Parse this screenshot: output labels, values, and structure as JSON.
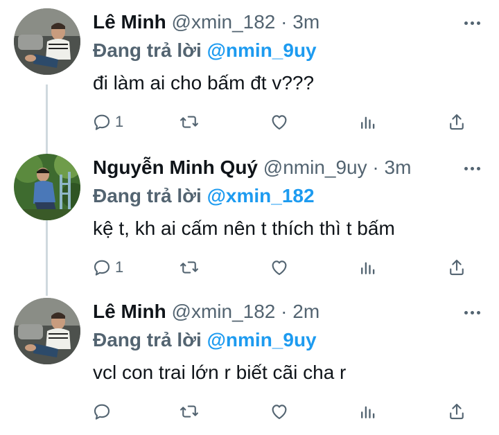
{
  "tweets": [
    {
      "name": "Lê Minh",
      "handle": "@xmin_182",
      "time": "· 3m",
      "reply_prefix": "Đang trả lời",
      "reply_to": "@nmin_9uy",
      "text": "đi làm ai cho bấm đt v???",
      "reply_count": "1",
      "avatar": "avatar-man-sitting-couch"
    },
    {
      "name": "Nguyễn Minh Quý",
      "handle": "@nmin_9uy",
      "time": "· 3m",
      "reply_prefix": "Đang trả lời",
      "reply_to": "@xmin_182",
      "text": "kệ t, kh ai cấm nên t thích thì t bấm",
      "reply_count": "1",
      "avatar": "avatar-man-outdoor-trees"
    },
    {
      "name": "Lê Minh",
      "handle": "@xmin_182",
      "time": "· 2m",
      "reply_prefix": "Đang trả lời",
      "reply_to": "@nmin_9uy",
      "text": "vcl con trai lớn r biết cãi cha r",
      "reply_count": "",
      "avatar": "avatar-man-sitting-couch"
    }
  ],
  "icons": {
    "reply": "reply-icon",
    "retweet": "retweet-icon",
    "like": "heart-icon",
    "analytics": "analytics-icon",
    "share": "share-icon",
    "more": "more-icon"
  },
  "colors": {
    "link": "#1d9bf0",
    "muted": "#536471",
    "text": "#0f1419",
    "thread_line": "#cfd9de"
  }
}
